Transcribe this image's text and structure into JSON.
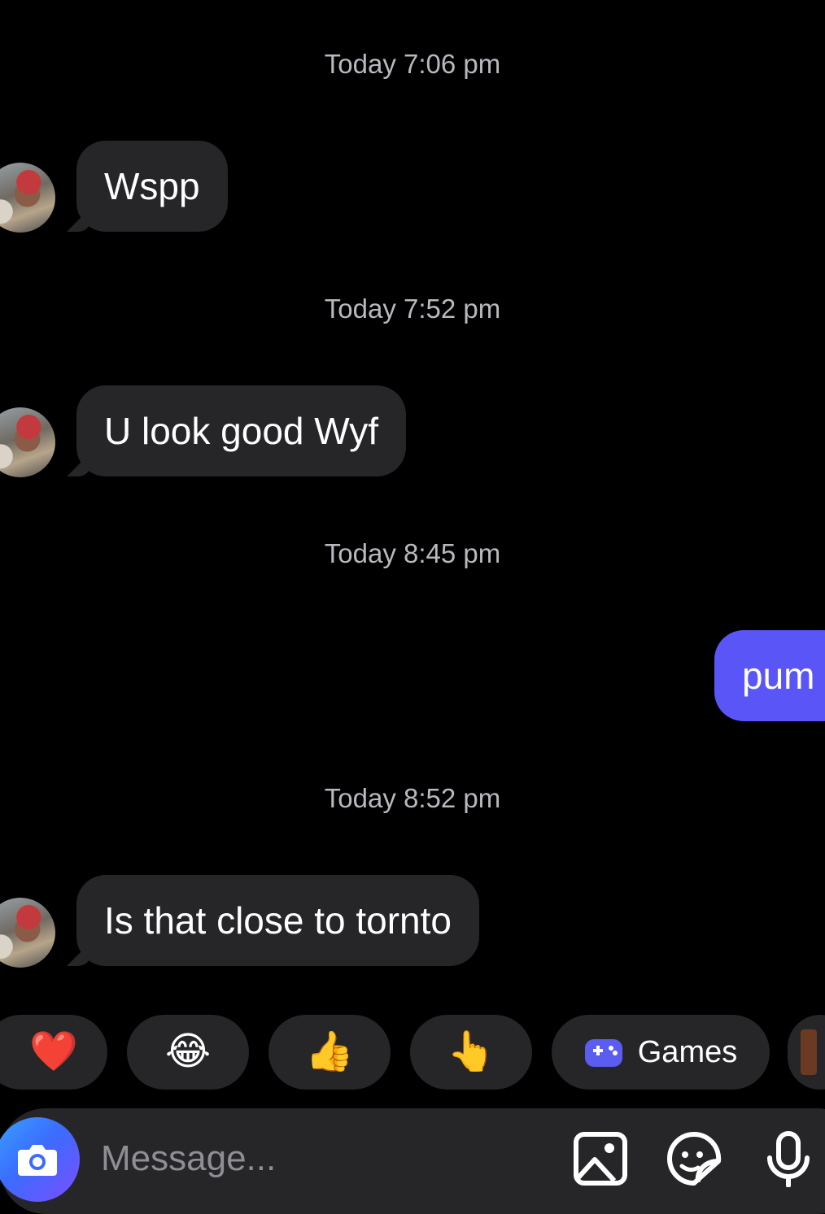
{
  "messages": [
    {
      "timestamp": "Today 7:06 pm",
      "text": "Wspp",
      "direction": "incoming"
    },
    {
      "timestamp": "Today 7:52 pm",
      "text": "U look good Wyf",
      "direction": "incoming"
    },
    {
      "timestamp": "Today 8:45 pm",
      "text": "pum",
      "direction": "outgoing"
    },
    {
      "timestamp": "Today 8:52 pm",
      "text": "Is that close to tornto",
      "direction": "incoming"
    }
  ],
  "quick_replies": {
    "items": [
      "❤️",
      "😂",
      "👍",
      "👆"
    ],
    "games_label": "Games"
  },
  "composer": {
    "placeholder": "Message..."
  },
  "colors": {
    "background": "#000000",
    "incoming_bubble": "#262629",
    "outgoing_bubble": "#5a55f7",
    "timestamp": "#b8b8be"
  },
  "icons": [
    "camera-icon",
    "gallery-icon",
    "sticker-icon",
    "microphone-icon",
    "gamepad-icon"
  ]
}
